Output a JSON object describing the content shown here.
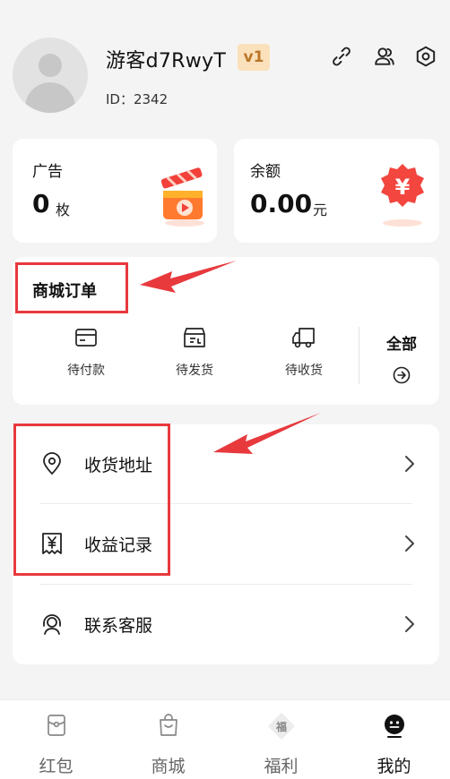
{
  "profile": {
    "username": "游客d7RwyT",
    "level_badge": "v1",
    "user_id": "ID：2342"
  },
  "stats": {
    "ads": {
      "label": "广告",
      "value": "0",
      "unit": "枚"
    },
    "balance": {
      "label": "余额",
      "value": "0.00",
      "unit": "元"
    }
  },
  "orders": {
    "title": "商城订单",
    "items": [
      {
        "label": "待付款",
        "icon": "card-icon"
      },
      {
        "label": "待发货",
        "icon": "package-icon"
      },
      {
        "label": "待收货",
        "icon": "truck-icon"
      }
    ],
    "all_label": "全部"
  },
  "menu": {
    "items": [
      {
        "label": "收货地址",
        "icon": "location-pin-icon"
      },
      {
        "label": "收益记录",
        "icon": "yen-receipt-icon"
      },
      {
        "label": "联系客服",
        "icon": "headset-icon"
      }
    ]
  },
  "bottom_nav": {
    "items": [
      {
        "label": "红包",
        "icon": "red-packet-icon"
      },
      {
        "label": "商城",
        "icon": "shopping-bag-icon"
      },
      {
        "label": "福利",
        "icon": "welfare-icon",
        "icon_text": "福"
      },
      {
        "label": "我的",
        "icon": "smiley-icon"
      }
    ],
    "active_index": 3
  },
  "colors": {
    "highlight": "#e8393d",
    "badge_bg": "#fbe1bb",
    "badge_text": "#b9772b"
  }
}
